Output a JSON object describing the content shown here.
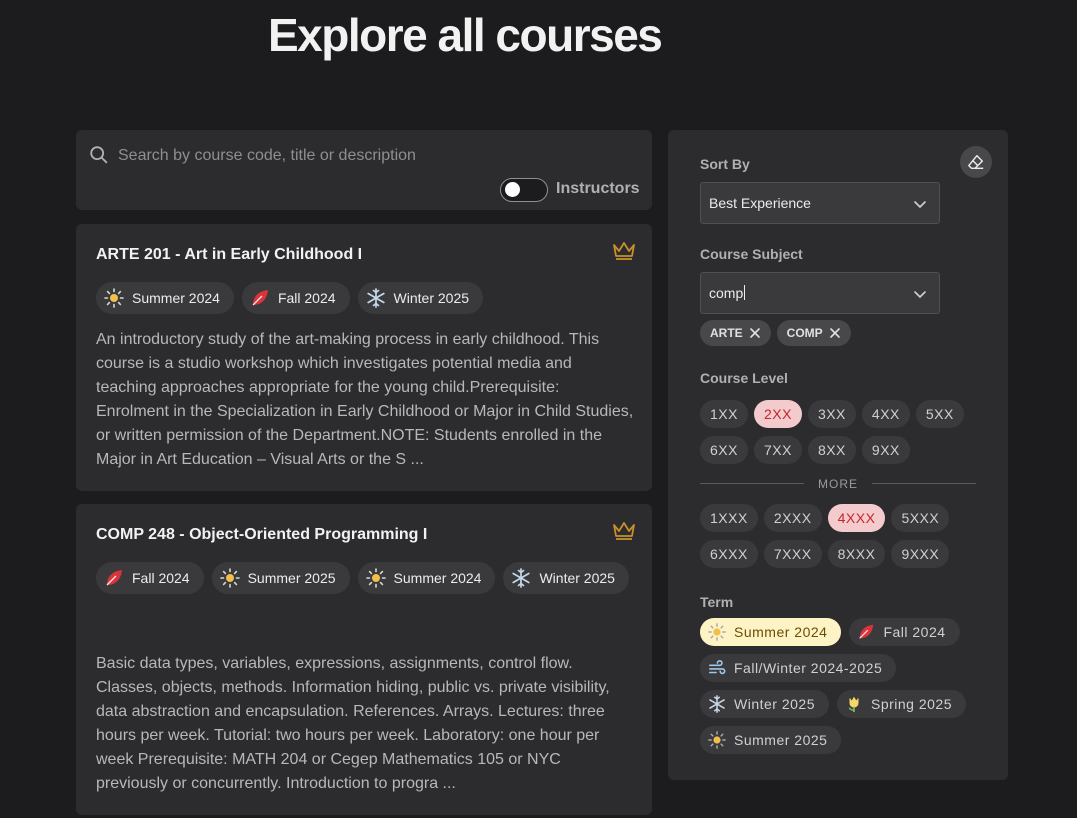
{
  "page": {
    "title": "Explore all courses"
  },
  "search": {
    "placeholder": "Search by course code, title or description",
    "instructors_label": "Instructors",
    "instructors_toggle_on": false
  },
  "courses": [
    {
      "title": "ARTE 201 - Art in Early Childhood I",
      "terms": [
        {
          "label": "Summer 2024",
          "icon": "sun-icon"
        },
        {
          "label": "Fall 2024",
          "icon": "leaf-icon"
        },
        {
          "label": "Winter 2025",
          "icon": "snowflake-icon"
        }
      ],
      "description": "An introductory study of the art-making process in early childhood. This course is a studio workshop which investigates potential media and teaching approaches appropriate for the young child.Prerequisite: Enrolment in the Specialization in Early Childhood or Major in Child Studies, or written permission of the Department.NOTE: Students enrolled in the Major in Art Education – Visual Arts or the S ..."
    },
    {
      "title": "COMP 248 - Object-Oriented Programming I",
      "terms": [
        {
          "label": "Fall 2024",
          "icon": "leaf-icon"
        },
        {
          "label": "Summer 2025",
          "icon": "sun-icon"
        },
        {
          "label": "Summer 2024",
          "icon": "sun-icon"
        },
        {
          "label": "Winter 2025",
          "icon": "snowflake-icon"
        }
      ],
      "description": "Basic data types, variables, expressions, assignments, control flow. Classes, objects, methods. Information hiding, public vs. private visibility, data abstraction and encapsulation. References. Arrays. Lectures: three hours per week. Tutorial: two hours per week. Laboratory: one hour per week Prerequisite: MATH 204 or Cegep Mathematics 105 or NYC previously or concurrently. Introduction to progra ..."
    }
  ],
  "filters": {
    "sort_by": {
      "label": "Sort By",
      "value": "Best Experience"
    },
    "subject": {
      "label": "Course Subject",
      "value": "comp",
      "tags": [
        "ARTE",
        "COMP"
      ]
    },
    "level": {
      "label": "Course Level",
      "levels": [
        "1XX",
        "2XX",
        "3XX",
        "4XX",
        "5XX",
        "6XX",
        "7XX",
        "8XX",
        "9XX"
      ],
      "selected_levels": [
        "2XX"
      ],
      "more_label": "MORE",
      "more_levels": [
        "1XXX",
        "2XXX",
        "4XXX",
        "5XXX",
        "6XXX",
        "7XXX",
        "8XXX",
        "9XXX"
      ],
      "selected_more": [
        "4XXX"
      ]
    },
    "term": {
      "label": "Term",
      "options": [
        {
          "label": "Summer 2024",
          "icon": "sun-icon",
          "selected": true
        },
        {
          "label": "Fall 2024",
          "icon": "leaf-icon",
          "selected": false
        },
        {
          "label": "Fall/Winter 2024-2025",
          "icon": "wind-icon",
          "selected": false
        },
        {
          "label": "Winter 2025",
          "icon": "snowflake-icon",
          "selected": false
        },
        {
          "label": "Spring 2025",
          "icon": "tulip-icon",
          "selected": false
        },
        {
          "label": "Summer 2025",
          "icon": "sun-icon",
          "selected": false
        }
      ]
    }
  },
  "colors": {
    "background": "#1c1c1e",
    "panel": "#2c2c2e",
    "crown": "#c8902a",
    "selected_level_bg": "#f4cbcd",
    "selected_term_bg": "#fdf3c4"
  }
}
